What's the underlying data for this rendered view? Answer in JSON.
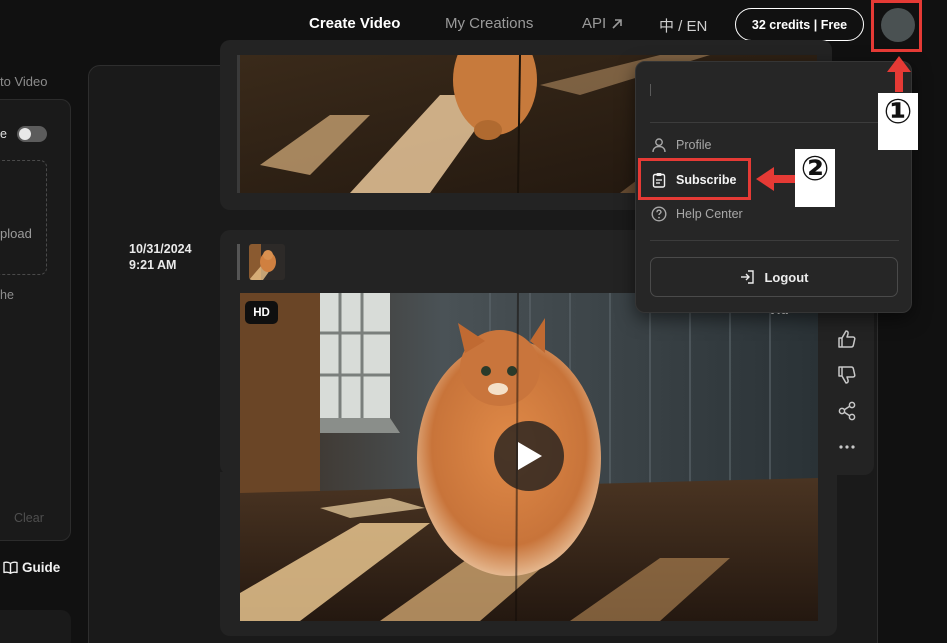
{
  "nav": {
    "create_video": "Create Video",
    "my_creations": "My Creations",
    "api": "API",
    "language": "中 / EN",
    "credits": "32 credits | Free",
    "avatar_icon": "avatar-icon"
  },
  "left_panel": {
    "title": "to Video",
    "toggle_label": "e",
    "upload_text": "pload",
    "the_text": "he",
    "clear": "Clear",
    "guide": "Guide",
    "guide_icon": "book-icon"
  },
  "feed": {
    "items": [
      {
        "date": "10/31/2024",
        "time": "9:21 AM",
        "badge": "HD",
        "video_label": "Vid",
        "actions": [
          "thumbs-up-icon",
          "thumbs-down-icon",
          "share-icon",
          "more-icon"
        ]
      }
    ]
  },
  "dropdown": {
    "profile": "Profile",
    "subscribe": "Subscribe",
    "help_center": "Help Center",
    "logout": "Logout"
  },
  "annotations": {
    "step1": "①",
    "step2": "②",
    "color": "#e53a35"
  },
  "colors": {
    "background": "#111111",
    "panel": "#1a1a1a",
    "card": "#232323",
    "dropdown": "#262626",
    "avatar": "#4a5152"
  }
}
